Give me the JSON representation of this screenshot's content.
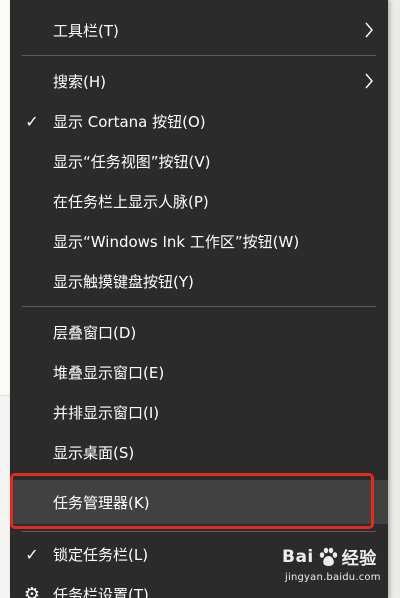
{
  "menu": {
    "items": [
      {
        "label": "工具栏(T)",
        "check": "",
        "submenu": true
      },
      {
        "label": "搜索(H)",
        "check": "",
        "submenu": true
      },
      {
        "label": "显示 Cortana 按钮(O)",
        "check": "✓",
        "submenu": false
      },
      {
        "label": "显示“任务视图”按钮(V)",
        "check": "",
        "submenu": false
      },
      {
        "label": "在任务栏上显示人脉(P)",
        "check": "",
        "submenu": false
      },
      {
        "label": "显示“Windows Ink 工作区”按钮(W)",
        "check": "",
        "submenu": false
      },
      {
        "label": "显示触摸键盘按钮(Y)",
        "check": "",
        "submenu": false
      },
      {
        "label": "层叠窗口(D)",
        "check": "",
        "submenu": false
      },
      {
        "label": "堆叠显示窗口(E)",
        "check": "",
        "submenu": false
      },
      {
        "label": "并排显示窗口(I)",
        "check": "",
        "submenu": false
      },
      {
        "label": "显示桌面(S)",
        "check": "",
        "submenu": false
      },
      {
        "label": "任务管理器(K)",
        "check": "",
        "submenu": false,
        "highlighted": true
      },
      {
        "label": "锁定任务栏(L)",
        "check": "✓",
        "submenu": false
      },
      {
        "label": "任务栏设置(T)",
        "icon": "gear-icon",
        "submenu": false
      }
    ],
    "check_glyph": "✓",
    "gear_glyph": "⚙"
  },
  "watermark": {
    "brand_left": "Bai",
    "brand_right": "经验",
    "url": "jingyan.baidu.com"
  },
  "colors": {
    "menu_bg": "#2b2b2b",
    "highlight_bg": "#414141",
    "separator": "#5c5c5c",
    "annotation_box": "#e02b20",
    "text": "#ffffff"
  }
}
